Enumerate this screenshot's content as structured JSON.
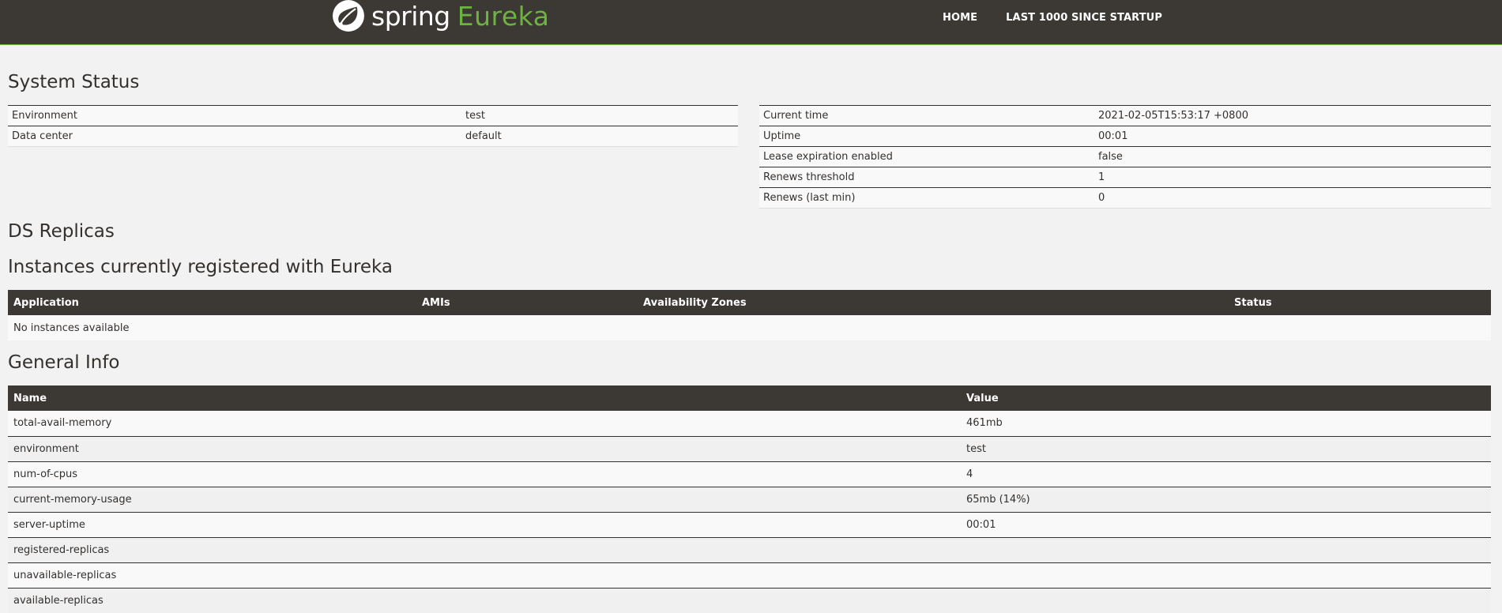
{
  "header": {
    "brand_spring": "spring",
    "brand_eureka": "Eureka",
    "nav": [
      {
        "label": "HOME"
      },
      {
        "label": "LAST 1000 SINCE STARTUP"
      }
    ]
  },
  "system_status": {
    "title": "System Status",
    "left": [
      {
        "label": "Environment",
        "value": "test"
      },
      {
        "label": "Data center",
        "value": "default"
      }
    ],
    "right": [
      {
        "label": "Current time",
        "value": "2021-02-05T15:53:17 +0800"
      },
      {
        "label": "Uptime",
        "value": "00:01"
      },
      {
        "label": "Lease expiration enabled",
        "value": "false"
      },
      {
        "label": "Renews threshold",
        "value": "1"
      },
      {
        "label": "Renews (last min)",
        "value": "0"
      }
    ]
  },
  "ds_replicas": {
    "title": "DS Replicas"
  },
  "instances": {
    "title": "Instances currently registered with Eureka",
    "columns": [
      "Application",
      "AMIs",
      "Availability Zones",
      "Status"
    ],
    "empty_text": "No instances available"
  },
  "general_info": {
    "title": "General Info",
    "columns": [
      "Name",
      "Value"
    ],
    "rows": [
      {
        "name": "total-avail-memory",
        "value": "461mb"
      },
      {
        "name": "environment",
        "value": "test"
      },
      {
        "name": "num-of-cpus",
        "value": "4"
      },
      {
        "name": "current-memory-usage",
        "value": "65mb (14%)"
      },
      {
        "name": "server-uptime",
        "value": "00:01"
      },
      {
        "name": "registered-replicas",
        "value": ""
      },
      {
        "name": "unavailable-replicas",
        "value": ""
      },
      {
        "name": "available-replicas",
        "value": ""
      }
    ]
  },
  "colors": {
    "header_bg": "#3c3834",
    "accent_green": "#6db33f",
    "page_bg": "#f2f2f2",
    "text": "#34302d"
  }
}
